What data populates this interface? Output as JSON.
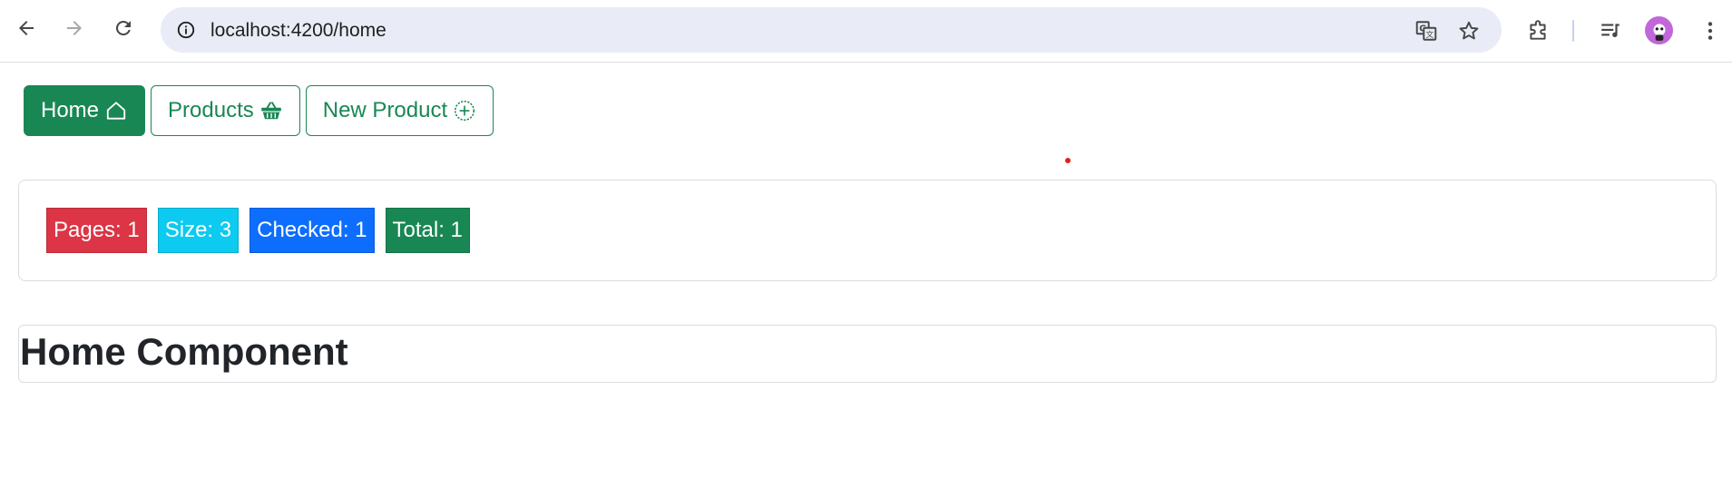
{
  "browser": {
    "url": "localhost:4200/home",
    "icons": {
      "back": "arrow-left-icon",
      "forward": "arrow-right-icon",
      "reload": "reload-icon",
      "site_info": "info-icon",
      "translate": "translate-icon",
      "bookmark": "star-icon",
      "extensions": "puzzle-icon",
      "media": "playlist-icon",
      "menu": "more-vertical-icon"
    }
  },
  "navbar": {
    "buttons": [
      {
        "label": "Home",
        "icon": "house-icon",
        "active": true
      },
      {
        "label": "Products",
        "icon": "basket-icon",
        "active": false
      },
      {
        "label": "New Product",
        "icon": "plus-circle-icon",
        "active": false
      }
    ]
  },
  "stats": [
    {
      "label": "Pages: 1",
      "color": "#dc3545"
    },
    {
      "label": "Size: 3",
      "color": "#0dcaf0"
    },
    {
      "label": "Checked: 1",
      "color": "#0d6efd"
    },
    {
      "label": "Total: 1",
      "color": "#198754"
    }
  ],
  "main": {
    "title": "Home Component"
  },
  "colors": {
    "primary": "#198754",
    "omnibox_bg": "#e9ecf6"
  }
}
